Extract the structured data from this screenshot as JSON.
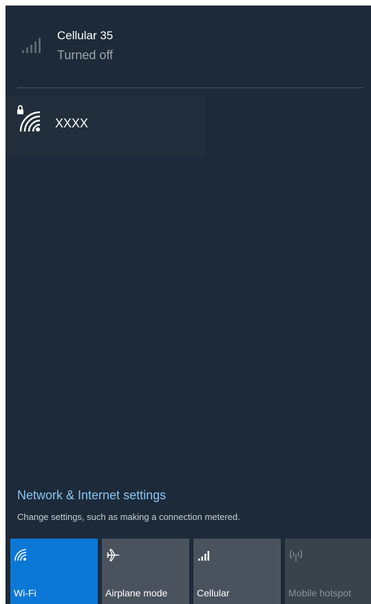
{
  "cellular_entry": {
    "name": "Cellular 35",
    "status": "Turned off",
    "icon": "signal-bars-icon"
  },
  "wifi_entry": {
    "name": "XXXX",
    "icon": "secured-wifi-icon"
  },
  "settings": {
    "link": "Network & Internet settings",
    "description": "Change settings, such as making a connection metered."
  },
  "quick_actions": [
    {
      "label": "Wi-Fi",
      "icon": "wifi-icon",
      "state": "on"
    },
    {
      "label": "Airplane mode",
      "icon": "airplane-icon",
      "state": "off"
    },
    {
      "label": "Cellular",
      "icon": "cellular-icon",
      "state": "off"
    },
    {
      "label": "Mobile hotspot",
      "icon": "hotspot-icon",
      "state": "disabled"
    }
  ],
  "colors": {
    "background": "#1d2a39",
    "accent": "#0b78d7",
    "link": "#8ac6f2",
    "tile": "#4a535d"
  }
}
